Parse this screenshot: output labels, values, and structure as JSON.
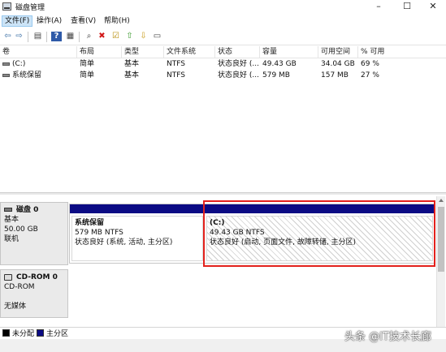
{
  "window": {
    "title": "磁盘管理",
    "minimize": "–",
    "maximize": "☐",
    "close": "✕"
  },
  "menu": [
    {
      "label": "文件(F)"
    },
    {
      "label": "操作(A)"
    },
    {
      "label": "查看(V)"
    },
    {
      "label": "帮助(H)"
    }
  ],
  "toolbar": {
    "icons": [
      "back-icon",
      "forward-icon",
      "console-tree-icon",
      "help-icon",
      "list-view-icon",
      "connect-icon",
      "delete-icon",
      "properties-icon",
      "import-icon",
      "export-icon",
      "settings-icon"
    ],
    "glyphs": {
      "back": "⇦",
      "forward": "⇨",
      "tree": "▤",
      "help": "?",
      "view": "▦",
      "connect": "⌕",
      "delete": "✖",
      "properties": "☑",
      "import": "⇧",
      "export": "⇩",
      "settings": "▭"
    }
  },
  "volumes": {
    "headers": [
      "卷",
      "布局",
      "类型",
      "文件系统",
      "状态",
      "容量",
      "可用空间",
      "% 可用"
    ],
    "rows": [
      {
        "name": "(C:)",
        "layout": "简单",
        "type": "基本",
        "fs": "NTFS",
        "status": "状态良好 (...",
        "capacity": "49.43 GB",
        "free": "34.04 GB",
        "pct": "69 %"
      },
      {
        "name": "系统保留",
        "layout": "简单",
        "type": "基本",
        "fs": "NTFS",
        "status": "状态良好 (...",
        "capacity": "579 MB",
        "free": "157 MB",
        "pct": "27 %"
      }
    ]
  },
  "disks": [
    {
      "name": "磁盘 0",
      "kind": "基本",
      "size": "50.00 GB",
      "state": "联机",
      "partitions": [
        {
          "name": "系统保留",
          "size": "579 MB NTFS",
          "status": "状态良好 (系统, 活动, 主分区)"
        },
        {
          "name": "(C:)",
          "size": "49.43 GB NTFS",
          "status": "状态良好 (启动, 页面文件, 故障转储, 主分区)"
        }
      ]
    },
    {
      "name": "CD-ROM 0",
      "kind": "CD-ROM",
      "state": "无媒体"
    }
  ],
  "legend": [
    {
      "label": "未分配",
      "color": "#000000"
    },
    {
      "label": "主分区",
      "color": "#0b0b84"
    }
  ],
  "watermark": "头条 @IT技术长廊",
  "colors": {
    "partition_bar": "#0b0b84",
    "highlight": "#e3211c"
  }
}
